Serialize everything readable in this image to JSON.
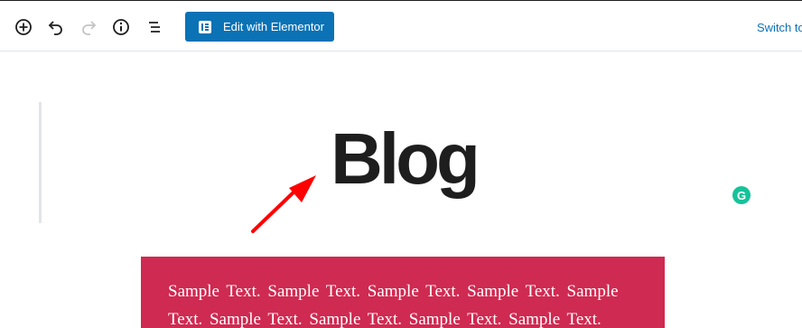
{
  "toolbar": {
    "buttons": [
      {
        "name": "add-block-button",
        "icon": "plus-circle-icon"
      },
      {
        "name": "undo-button",
        "icon": "undo-icon"
      },
      {
        "name": "redo-button",
        "icon": "redo-icon"
      },
      {
        "name": "info-button",
        "icon": "info-icon"
      },
      {
        "name": "outline-button",
        "icon": "list-icon"
      }
    ],
    "elementor_label": "Edit with Elementor",
    "switch_label": "Switch to",
    "accent_color": "#0a72b5"
  },
  "content": {
    "title": "Blog",
    "sample_text": "Sample Text. Sample Text.  Sample Text.  Sample Text.  Sample Text.  Sample Text.  Sample Text.  Sample Text.  Sample Text.",
    "block_color": "#cf2a51",
    "annotation_arrow_color": "#ff0000"
  },
  "grammarly": {
    "letter": "G",
    "color": "#15c39a"
  }
}
